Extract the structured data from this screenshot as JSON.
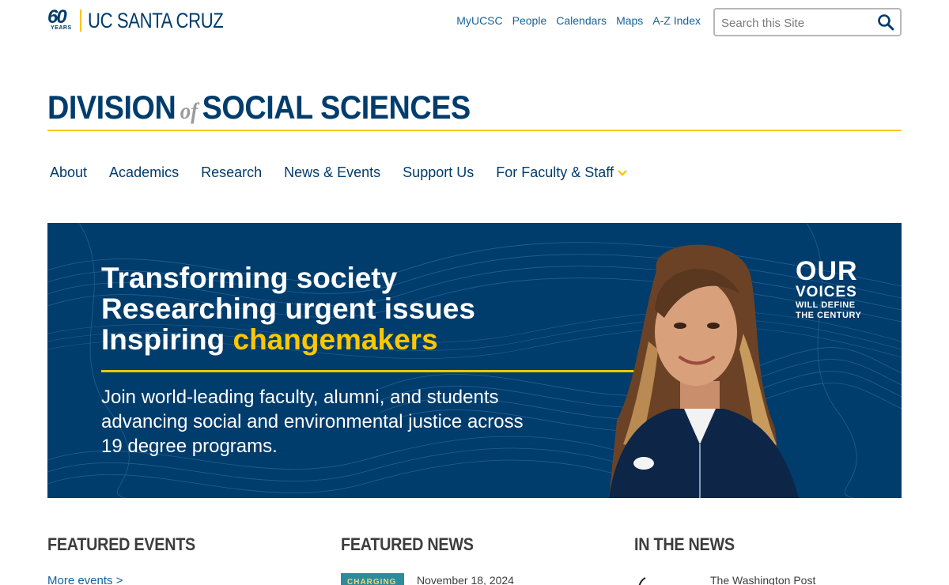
{
  "logo": {
    "anniversary_number": "60",
    "anniversary_label": "YEARS",
    "name": "UC SANTA CRUZ"
  },
  "utility_nav": {
    "items": [
      "MyUCSC",
      "People",
      "Calendars",
      "Maps",
      "A-Z Index"
    ]
  },
  "search": {
    "placeholder": "Search this Site",
    "icon": "search-icon"
  },
  "division": {
    "part1": "DIVISION",
    "part2": "of",
    "part3": "SOCIAL SCIENCES"
  },
  "main_nav": {
    "items": [
      "About",
      "Academics",
      "Research",
      "News & Events",
      "Support Us",
      "For Faculty & Staff"
    ],
    "dropdown_icon": "chevron-down-icon"
  },
  "hero": {
    "line1": "Transforming society",
    "line2": "Researching urgent issues",
    "line3_prefix": "Inspiring ",
    "line3_accent": "changemakers",
    "subtext": "Join world-leading faculty, alumni, and students advancing social and environmental justice across 19 degree programs.",
    "badge_line1": "OUR",
    "badge_line2": "VOICES",
    "badge_line3": "WILL DEFINE",
    "badge_line4": "THE CENTURY"
  },
  "sections": {
    "events": {
      "title": "FEATURED EVENTS",
      "link": "More events >"
    },
    "news": {
      "title": "FEATURED NEWS",
      "thumb_text": "CHARGING",
      "date": "November 18, 2024"
    },
    "in_the_news": {
      "title": "IN THE NEWS",
      "source": "The Washington Post"
    }
  },
  "colors": {
    "brand_blue": "#003c6c",
    "brand_gold": "#fdc700",
    "link_blue": "#13639e",
    "heading_gray": "#3d3d3d"
  }
}
